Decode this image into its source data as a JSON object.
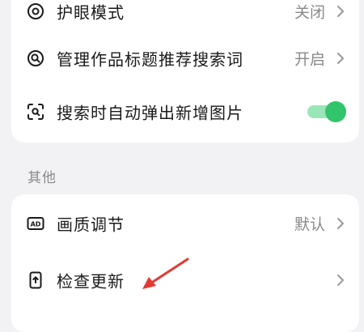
{
  "settings_top": {
    "items": [
      {
        "label": "护眼模式",
        "value": "关闭",
        "icon": "eye-protection-icon"
      },
      {
        "label": "管理作品标题推荐搜索词",
        "value": "开启",
        "icon": "search-keyword-icon"
      },
      {
        "label": "搜索时自动弹出新增图片",
        "toggle_on": true,
        "icon": "image-scan-icon"
      }
    ]
  },
  "section_other": {
    "title": "其他",
    "items": [
      {
        "label": "画质调节",
        "value": "默认",
        "icon": "hd-quality-icon"
      },
      {
        "label": "检查更新",
        "value": "",
        "icon": "phone-update-icon"
      }
    ]
  },
  "annotation": {
    "arrow_color": "#e53935"
  },
  "colors": {
    "toggle_on_track": "#9be6b8",
    "toggle_on_knob": "#32c56b"
  }
}
